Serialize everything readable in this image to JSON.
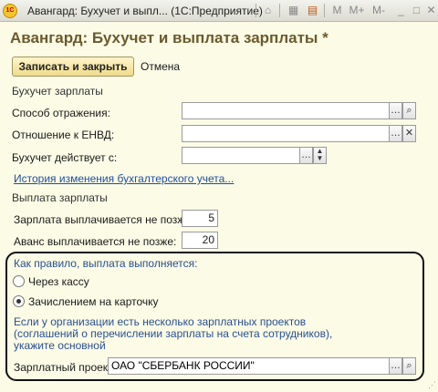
{
  "window": {
    "title": "Авангард: Бухучет и выпл... (1С:Предприятие)",
    "logo_text": "1С",
    "toolbar_icons": [
      "home-icon",
      "calculator-icon",
      "calendar-icon"
    ],
    "toolbar_text_buttons": [
      "M",
      "M+",
      "M-"
    ]
  },
  "form": {
    "heading": "Авангард: Бухучет и выплата зарплаты *",
    "save_close_label": "Записать и закрыть",
    "cancel_label": "Отмена"
  },
  "accounting": {
    "section_label": "Бухучет зарплаты",
    "method_label": "Способ отражения:",
    "method_value": "",
    "envd_label": "Отношение к ЕНВД:",
    "envd_value": "",
    "effective_label": "Бухучет действует с:",
    "effective_value": "",
    "history_link": "История изменения бухгалтерского учета..."
  },
  "payment": {
    "section_label": "Выплата зарплаты",
    "salary_label": "Зарплата выплачивается не позже:",
    "salary_value": "5",
    "advance_label": "Аванс выплачивается не позже:",
    "advance_value": "20",
    "usually_label": "Как правило, выплата выполняется:",
    "option_cash": "Через кассу",
    "option_card": "Зачислением на карточку",
    "selected_option": "option_card",
    "note_line1": "Если у организации есть несколько зарплатных проектов",
    "note_line2": "(соглашений о перечислении зарплаты на счета сотрудников),",
    "note_line3": "укажите основной",
    "project_label": "Зарплатный проект:",
    "project_value": "ОАО \"СБЕРБАНК РОССИИ\""
  }
}
